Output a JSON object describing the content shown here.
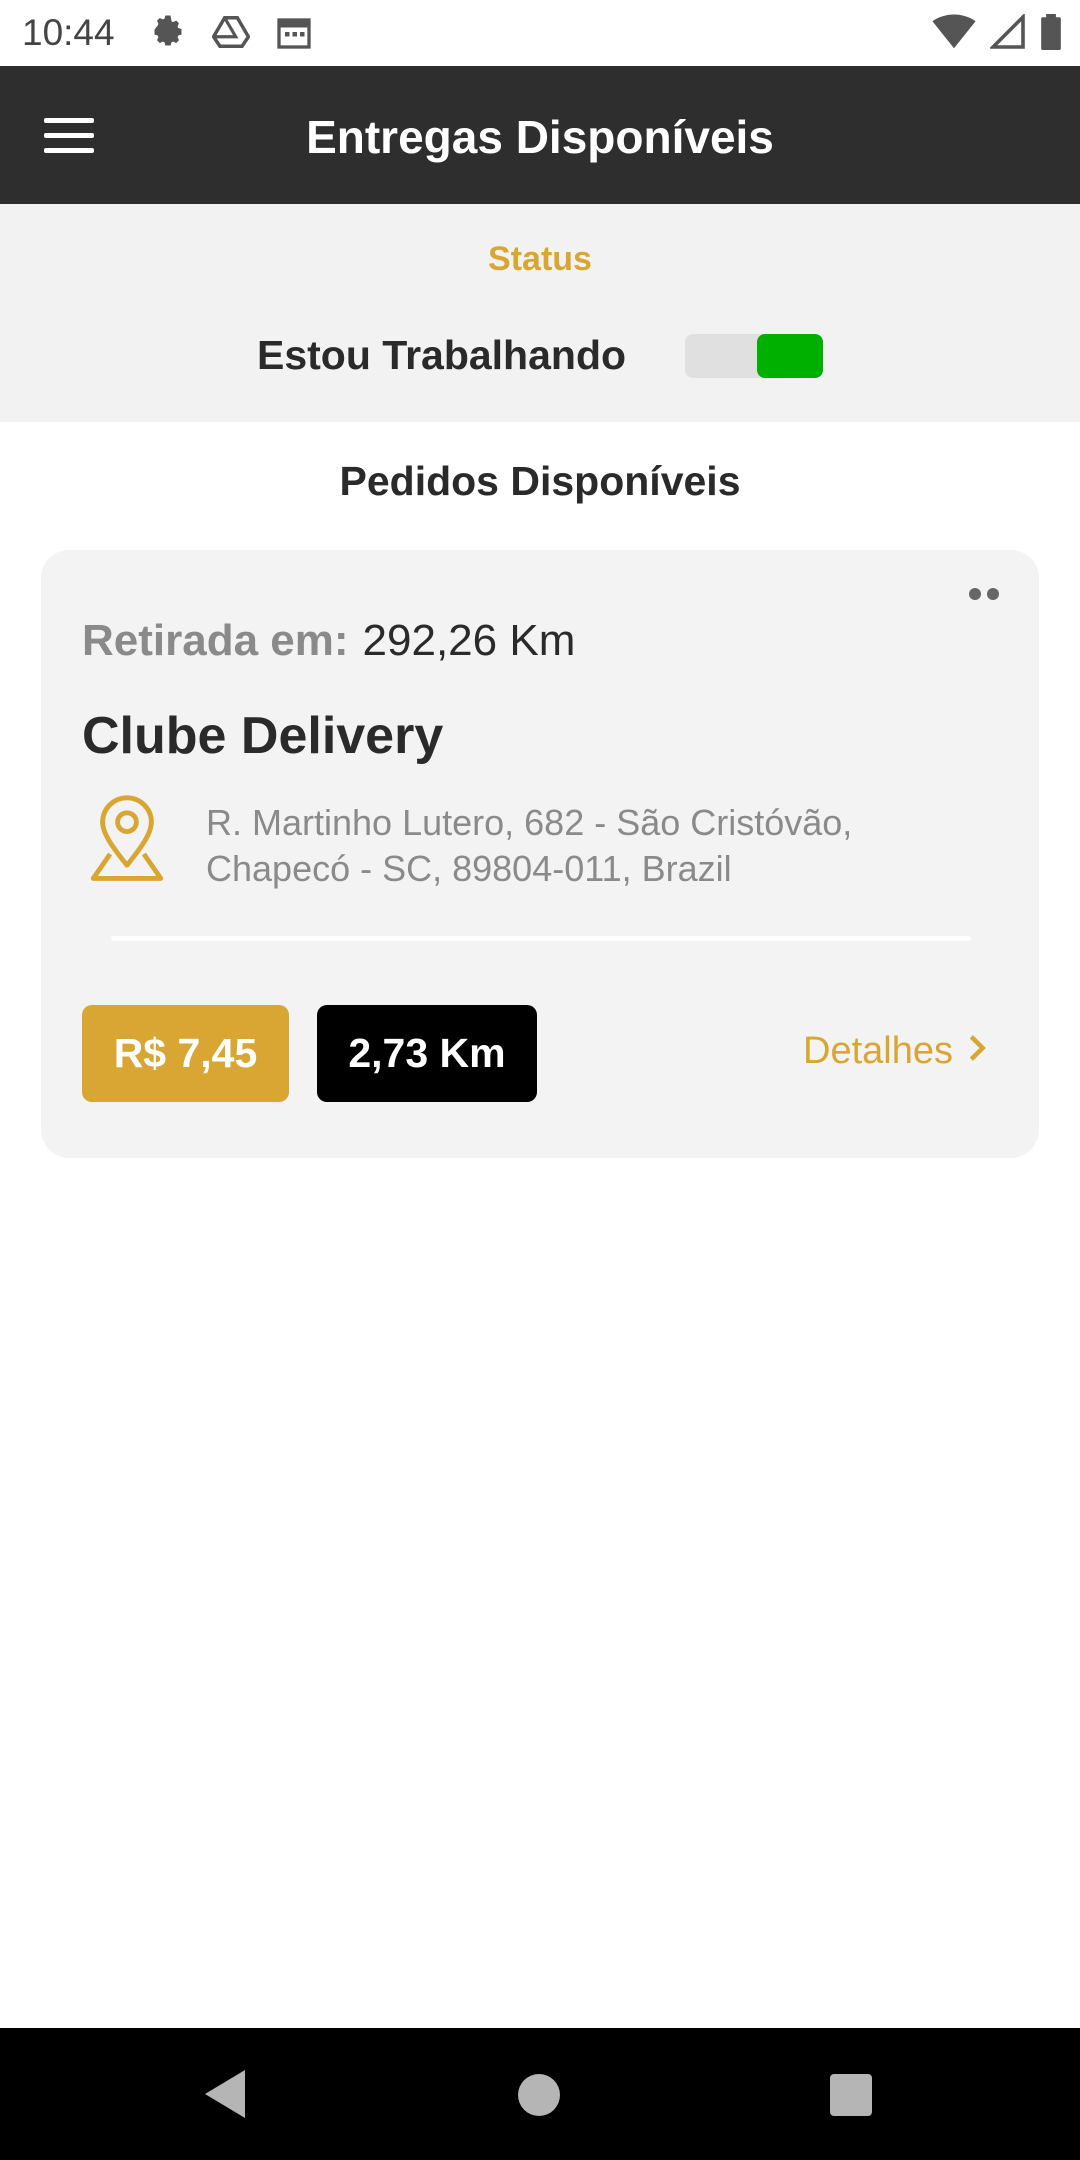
{
  "status_bar": {
    "time": "10:44",
    "left_icons": [
      "gear-icon",
      "drive-icon",
      "calendar-icon"
    ],
    "right_icons": [
      "wifi-icon",
      "signal-icon",
      "battery-icon"
    ]
  },
  "app_bar": {
    "title": "Entregas Disponíveis"
  },
  "status_section": {
    "title": "Status",
    "working_label": "Estou Trabalhando",
    "working_toggle_on": true,
    "toggle_color": "#00b000"
  },
  "orders": {
    "title": "Pedidos Disponíveis",
    "items": [
      {
        "pickup_label": "Retirada em:",
        "pickup_distance": "292,26 Km",
        "store_name": "Clube Delivery",
        "address": "R. Martinho Lutero, 682 - São Cristóvão, Chapecó - SC, 89804-011, Brazil",
        "price": "R$ 7,45",
        "distance": "2,73 Km",
        "details_label": "Detalhes"
      }
    ]
  },
  "colors": {
    "accent": "#d9a633",
    "appbar": "#2e2e2e",
    "toggle_on": "#00b000"
  }
}
